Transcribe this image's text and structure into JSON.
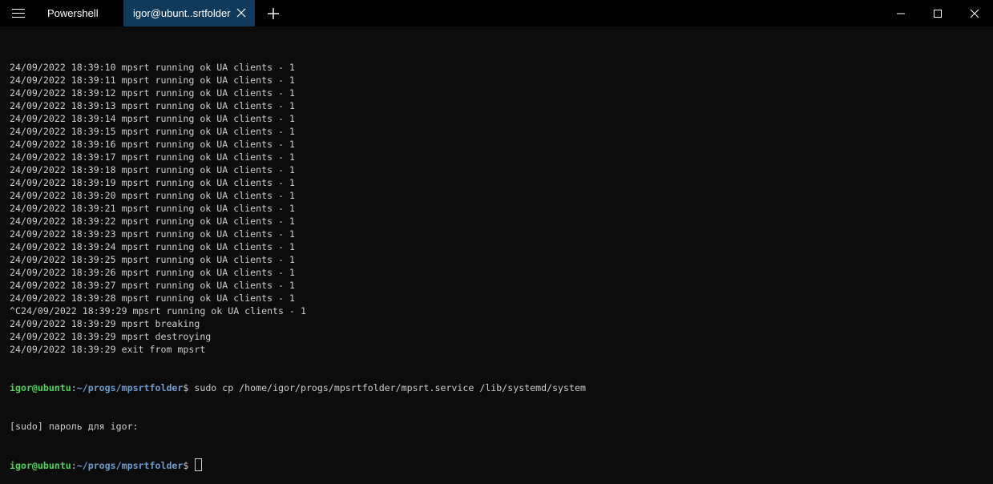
{
  "tabs": [
    {
      "label": "Powershell"
    },
    {
      "label": "igor@ubunt..srtfolder"
    }
  ],
  "terminal": {
    "log_lines": [
      "24/09/2022 18:39:10 mpsrt running ok UA clients - 1",
      "24/09/2022 18:39:11 mpsrt running ok UA clients - 1",
      "24/09/2022 18:39:12 mpsrt running ok UA clients - 1",
      "24/09/2022 18:39:13 mpsrt running ok UA clients - 1",
      "24/09/2022 18:39:14 mpsrt running ok UA clients - 1",
      "24/09/2022 18:39:15 mpsrt running ok UA clients - 1",
      "24/09/2022 18:39:16 mpsrt running ok UA clients - 1",
      "24/09/2022 18:39:17 mpsrt running ok UA clients - 1",
      "24/09/2022 18:39:18 mpsrt running ok UA clients - 1",
      "24/09/2022 18:39:19 mpsrt running ok UA clients - 1",
      "24/09/2022 18:39:20 mpsrt running ok UA clients - 1",
      "24/09/2022 18:39:21 mpsrt running ok UA clients - 1",
      "24/09/2022 18:39:22 mpsrt running ok UA clients - 1",
      "24/09/2022 18:39:23 mpsrt running ok UA clients - 1",
      "24/09/2022 18:39:24 mpsrt running ok UA clients - 1",
      "24/09/2022 18:39:25 mpsrt running ok UA clients - 1",
      "24/09/2022 18:39:26 mpsrt running ok UA clients - 1",
      "24/09/2022 18:39:27 mpsrt running ok UA clients - 1",
      "24/09/2022 18:39:28 mpsrt running ok UA clients - 1",
      "^C24/09/2022 18:39:29 mpsrt running ok UA clients - 1",
      "24/09/2022 18:39:29 mpsrt breaking",
      "24/09/2022 18:39:29 mpsrt destroying",
      "24/09/2022 18:39:29 exit from mpsrt"
    ],
    "prompt_user": "igor@ubuntu",
    "prompt_colon": ":",
    "prompt_path": "~/progs/mpsrtfolder",
    "prompt_dollar": "$",
    "command": " sudo cp /home/igor/progs/mpsrtfolder/mpsrt.service /lib/systemd/system",
    "sudo_prompt": "[sudo] пароль для igor:"
  },
  "colors": {
    "background": "#0c0c0c",
    "text": "#cccccc",
    "prompt_user": "#4fd15a",
    "prompt_path": "#6d9ccc",
    "active_tab": "#0f3a5c"
  },
  "icons": {
    "menu": "hamburger-icon",
    "close_tab": "close-icon",
    "new_tab": "plus-icon",
    "minimize": "minimize-icon",
    "maximize": "maximize-icon",
    "close_window": "close-icon"
  }
}
